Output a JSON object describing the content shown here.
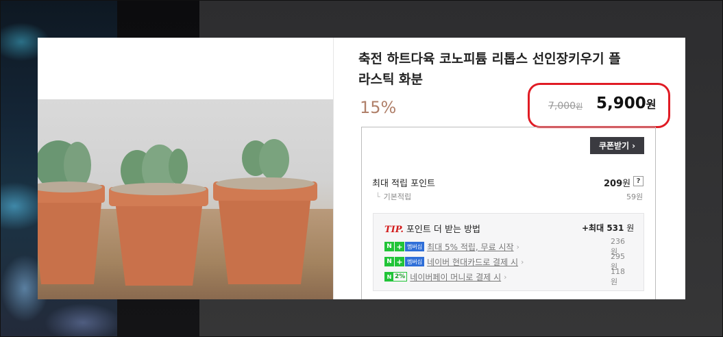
{
  "product": {
    "title_line1": "축전 하트다육 코노피튬 리톱스 선인장키우기 플",
    "title_line2": "라스틱 화분",
    "discount_rate": "15%",
    "original_price": "7,000",
    "original_price_unit": "원",
    "sale_price": "5,900",
    "sale_price_unit": "원"
  },
  "coupon": {
    "label": "쿠폰받기",
    "chevron": "›"
  },
  "points": {
    "max_label": "최대 적립 포인트",
    "max_value": "209",
    "max_unit": "원",
    "help_icon": "?",
    "base_tick": "└",
    "base_label": "기본적립",
    "base_value": "59원"
  },
  "tip": {
    "tip_word": "TIP.",
    "heading": "포인트 더 받는 방법",
    "max_prefix": "+최대 ",
    "max_value": "531",
    "max_unit": " 원",
    "rows": [
      {
        "badge_n": "N",
        "badge_plus": "+",
        "badge_mem": "멤버십",
        "text": "최대 5% 적립, 무료 시작",
        "chevron": "›",
        "amount": "236원"
      },
      {
        "badge_n": "N",
        "badge_plus": "+",
        "badge_mem": "멤버십",
        "text": "네이버 현대카드로 결제 시",
        "chevron": "›",
        "amount": "295원"
      },
      {
        "badge_n": "N",
        "badge_pct": "2%",
        "text": "네이버페이 머니로 결제 시",
        "chevron": "›",
        "amount": "118원"
      }
    ]
  },
  "colors": {
    "discount": "#b0806a",
    "highlight_circle": "#e01b24",
    "naver_green": "#21c438",
    "membership_blue": "#2f6fd8",
    "coupon_bg": "#3a3a40",
    "tip_red": "#d21b1b"
  },
  "icons": {
    "coupon_chevron": "chevron-right-icon",
    "help": "question-icon",
    "naver": "naver-n-icon"
  }
}
